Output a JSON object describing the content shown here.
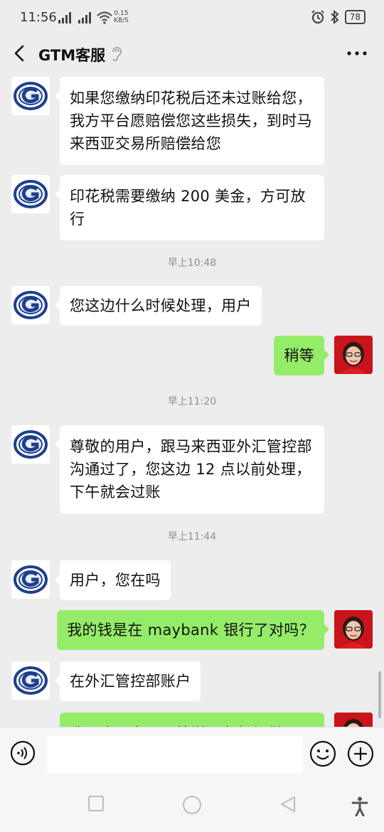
{
  "status_bar": {
    "time": "11:56",
    "net_speed_value": "0.15",
    "net_speed_unit": "KB/S",
    "battery": "78"
  },
  "header": {
    "title": "GTM客服"
  },
  "messages": [
    {
      "side": "left",
      "text": "如果您缴纳印花税后还未过账给您，我方平台愿赔偿您这些损失，到时马来西亚交易所赔偿给您"
    },
    {
      "side": "left",
      "text": "印花税需要缴纳 200 美金，方可放行"
    },
    {
      "side": "time",
      "text": "早上10:48"
    },
    {
      "side": "left",
      "text": "您这边什么时候处理，用户"
    },
    {
      "side": "right",
      "text": "稍等"
    },
    {
      "side": "time",
      "text": "早上11:20"
    },
    {
      "side": "left",
      "text": "尊敬的用户，跟马来西亚外汇管控部沟通过了，您这边 12 点以前处理，下午就会过账"
    },
    {
      "side": "time",
      "text": "早上11:44"
    },
    {
      "side": "left",
      "text": "用户，您在吗"
    },
    {
      "side": "right",
      "text": "我的钱是在 maybank 银行了对吗？"
    },
    {
      "side": "left",
      "text": "在外汇管控部账户"
    },
    {
      "side": "right",
      "text": "我跟大公东三，外送没有任何税要"
    }
  ],
  "input": {
    "value": ""
  },
  "colors": {
    "sent_bubble": "#95ec69",
    "received_bubble": "#ffffff",
    "background": "#ededed"
  }
}
